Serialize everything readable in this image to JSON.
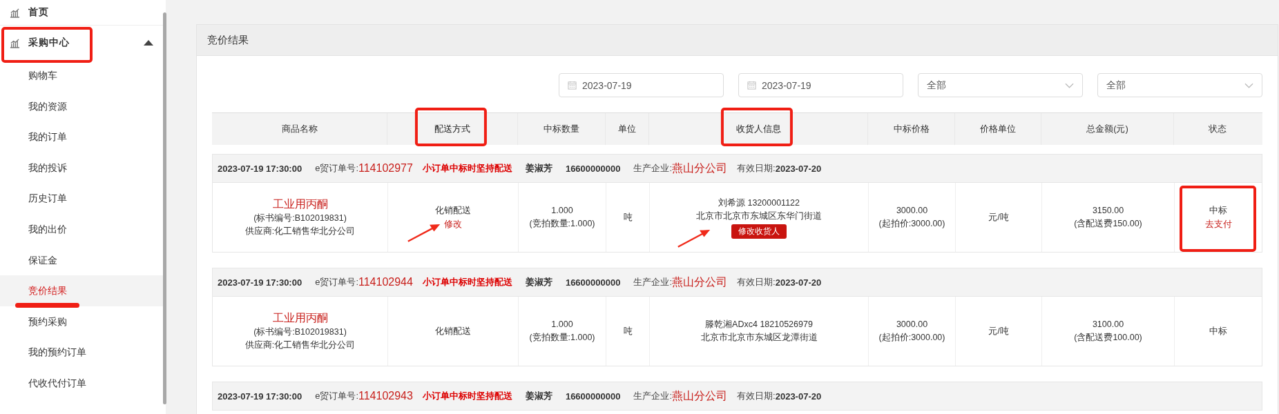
{
  "sidebar": {
    "items": [
      {
        "label": "首页",
        "kind": "section",
        "highlighted": false
      },
      {
        "label": "采购中心",
        "kind": "section",
        "highlighted": true,
        "expanded": true,
        "children": [
          {
            "label": "购物车",
            "selected": false
          },
          {
            "label": "我的资源",
            "selected": false
          },
          {
            "label": "我的订单",
            "selected": false
          },
          {
            "label": "我的投诉",
            "selected": false
          },
          {
            "label": "历史订单",
            "selected": false
          },
          {
            "label": "我的出价",
            "selected": false
          },
          {
            "label": "保证金",
            "selected": false
          },
          {
            "label": "竞价结果",
            "selected": true,
            "underlined": true
          },
          {
            "label": "预约采购",
            "selected": false
          },
          {
            "label": "我的预约订单",
            "selected": false
          },
          {
            "label": "代收代付订单",
            "selected": false
          }
        ]
      }
    ]
  },
  "panel": {
    "title": "竞价结果"
  },
  "filters": [
    {
      "kind": "date",
      "value": "2023-07-19"
    },
    {
      "kind": "date",
      "value": "2023-07-19"
    },
    {
      "kind": "select",
      "value": "全部"
    },
    {
      "kind": "select",
      "value": "全部"
    }
  ],
  "table": {
    "columns": [
      {
        "label": "商品名称",
        "highlighted": false
      },
      {
        "label": "配送方式",
        "highlighted": true
      },
      {
        "label": "中标数量",
        "highlighted": false
      },
      {
        "label": "单位",
        "highlighted": false
      },
      {
        "label": "收货人信息",
        "highlighted": true
      },
      {
        "label": "中标价格",
        "highlighted": false
      },
      {
        "label": "价格单位",
        "highlighted": false
      },
      {
        "label": "总金额(元)",
        "highlighted": false
      },
      {
        "label": "状态",
        "highlighted": false
      }
    ],
    "orders": [
      {
        "time": "2023-07-19 17:30:00",
        "order_label": "e贸订单号:",
        "order_no": "114102977",
        "notice": "小订单中标时坚持配送",
        "contact": "姜淑芳",
        "phone": "16600000000",
        "producer_label": "生产企业:",
        "producer": "燕山分公司",
        "expiry_label": "有效日期:",
        "expiry": "2023-07-20",
        "product": "工业用丙酮",
        "tender_no": "(标书编号:B102019831)",
        "supplier": "供应商:化工销售华北分公司",
        "delivery": "化销配送",
        "delivery_edit": {
          "label": "修改",
          "arrow": true
        },
        "quantity": "1.000",
        "bid_quantity": "(竞拍数量:1.000)",
        "unit": "吨",
        "consignee": "刘希源 13200001122",
        "address": "北京市北京市东城区东华门街道",
        "consignee_button": {
          "label": "修改收货人",
          "arrow": true
        },
        "price": "3000.00",
        "start_price": "(起拍价:3000.00)",
        "price_unit": "元/吨",
        "total": "3150.00",
        "total_note": "(含配送费150.00)",
        "status": "中标",
        "pay_link": "去支付",
        "status_highlighted": true
      },
      {
        "time": "2023-07-19 17:30:00",
        "order_label": "e贸订单号:",
        "order_no": "114102944",
        "notice": "小订单中标时坚持配送",
        "contact": "姜淑芳",
        "phone": "16600000000",
        "producer_label": "生产企业:",
        "producer": "燕山分公司",
        "expiry_label": "有效日期:",
        "expiry": "2023-07-20",
        "product": "工业用丙酮",
        "tender_no": "(标书编号:B102019831)",
        "supplier": "供应商:化工销售华北分公司",
        "delivery": "化销配送",
        "quantity": "1.000",
        "bid_quantity": "(竞拍数量:1.000)",
        "unit": "吨",
        "consignee": "滕乾湘ADxc4 18210526979",
        "address": "北京市北京市东城区龙潭街道",
        "price": "3000.00",
        "start_price": "(起拍价:3000.00)",
        "price_unit": "元/吨",
        "total": "3100.00",
        "total_note": "(含配送费100.00)",
        "status": "中标",
        "status_highlighted": false
      },
      {
        "time": "2023-07-19 17:30:00",
        "order_label": "e贸订单号:",
        "order_no": "114102943",
        "notice": "小订单中标时坚持配送",
        "contact": "姜淑芳",
        "phone": "16600000000",
        "producer_label": "生产企业:",
        "producer": "燕山分公司",
        "expiry_label": "有效日期:",
        "expiry": "2023-07-20"
      }
    ]
  }
}
